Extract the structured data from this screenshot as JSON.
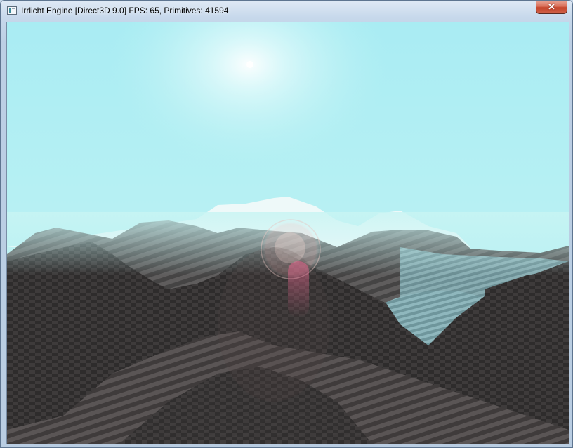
{
  "window": {
    "title": "Irrlicht Engine [Direct3D 9.0] FPS: 65, Primitives: 41594",
    "icon": "irrlicht-app-icon",
    "close_glyph": "✕"
  },
  "scene": {
    "sky_color": "#b5f1f3",
    "terrain_color": "#3b3838"
  }
}
